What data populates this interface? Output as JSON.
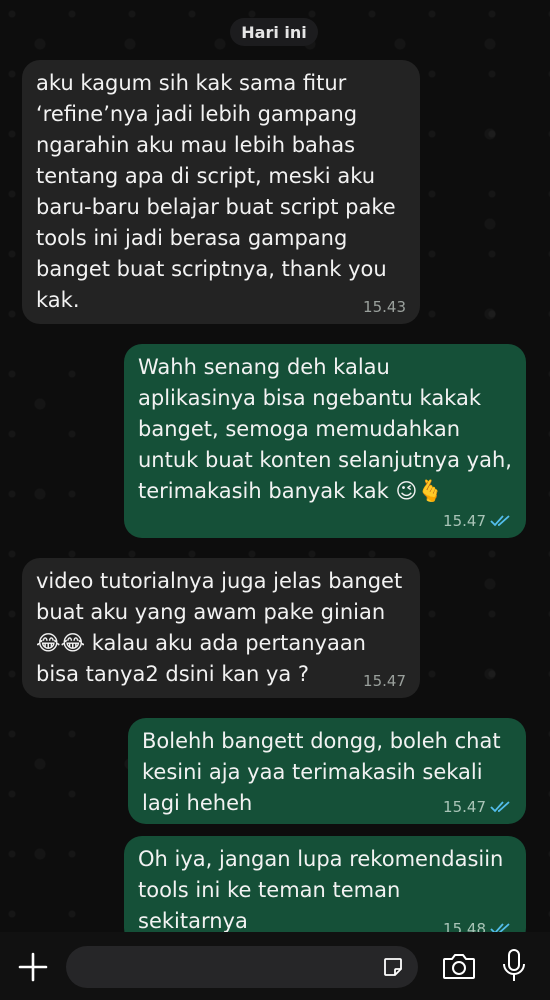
{
  "date_label": "Hari ini",
  "messages": [
    {
      "dir": "in",
      "text": "aku kagum sih kak sama fitur\n‘refine’nya jadi lebih gampang\nngarahin aku mau lebih bahas\ntentang apa di script, meski aku\nbaru-baru belajar buat script pake\ntools ini jadi berasa gampang\nbanget buat scriptnya, thank you\nkak.",
      "time": "15.43"
    },
    {
      "dir": "out",
      "text": "Wahh senang deh kalau\naplikasinya bisa ngebantu kakak\nbanget, semoga memudahkan\nuntuk buat konten selanjutnya yah,\nterimakasih banyak kak",
      "emoji": "😉🫰",
      "time": "15.47"
    },
    {
      "dir": "in",
      "text_lines": [
        "video tutorialnya juga jelas banget",
        "buat aku yang awam pake ginian",
        "kalau aku ada pertanyaan",
        "bisa tanya2 dsini kan ya ?"
      ],
      "emoji": "😂😂",
      "time": "15.47"
    },
    {
      "dir": "out",
      "text": "Bolehh bangett dongg, boleh chat\nkesini aja yaa terimakasih sekali\nlagi heheh",
      "time": "15.47"
    },
    {
      "dir": "out",
      "text": "Oh iya, jangan lupa rekomendasiin\ntools ini ke teman teman sekitarnya\nya",
      "emoji": "🤩🤩",
      "time": "15.48"
    }
  ],
  "colors": {
    "incoming": "#232323",
    "outgoing": "#155038",
    "read_ticks": "#53bdeb"
  },
  "icons": [
    "plus-icon",
    "sticker-icon",
    "camera-icon",
    "mic-icon",
    "double-check-icon",
    "wink-emoji",
    "pinch-hand-emoji",
    "laugh-tears-emoji",
    "star-struck-emoji"
  ]
}
